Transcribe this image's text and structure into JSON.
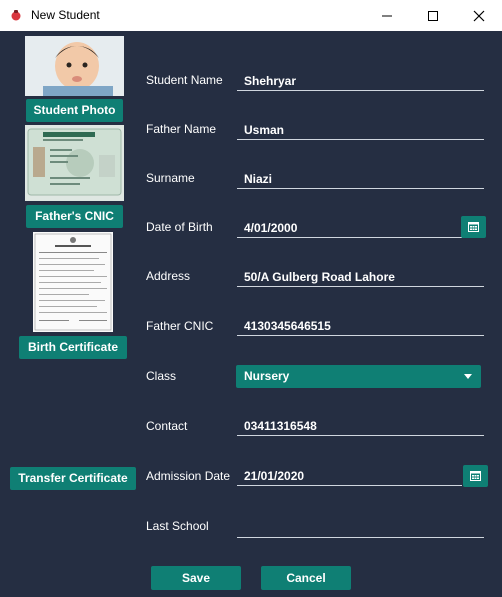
{
  "window": {
    "title": "New Student"
  },
  "photos": {
    "student_photo_label": "Student Photo",
    "fathers_cnic_label": "Father's CNIC",
    "birth_certificate_label": "Birth Certificate",
    "transfer_certificate_label": "Transfer Certificate"
  },
  "form": {
    "student_name": {
      "label": "Student Name",
      "value": "Shehryar"
    },
    "father_name": {
      "label": "Father Name",
      "value": "Usman"
    },
    "surname": {
      "label": "Surname",
      "value": "Niazi"
    },
    "date_of_birth": {
      "label": "Date of Birth",
      "value": "4/01/2000"
    },
    "address": {
      "label": "Address",
      "value": "50/A Gulberg Road Lahore"
    },
    "father_cnic": {
      "label": "Father CNIC",
      "value": "4130345646515"
    },
    "class": {
      "label": "Class",
      "value": "Nursery"
    },
    "contact": {
      "label": "Contact",
      "value": "03411316548"
    },
    "admission_date": {
      "label": "Admission Date",
      "value": "21/01/2020"
    },
    "last_school": {
      "label": "Last School",
      "value": ""
    }
  },
  "actions": {
    "save_label": "Save",
    "cancel_label": "Cancel"
  },
  "colors": {
    "background": "#252e42",
    "accent": "#0f7f74",
    "text": "#ffffff"
  }
}
